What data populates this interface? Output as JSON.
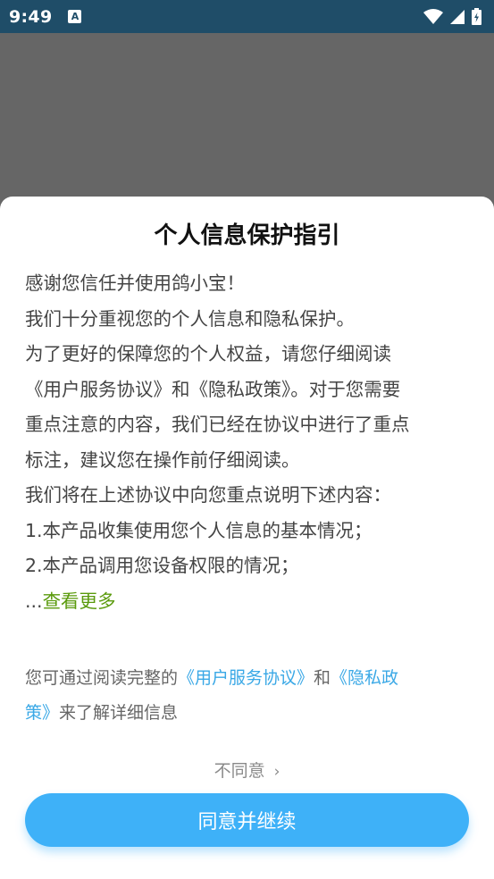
{
  "status_bar": {
    "time": "9:49",
    "notification_icon": "A",
    "icons": [
      "wifi-icon",
      "signal-icon",
      "battery-icon"
    ]
  },
  "dialog": {
    "title": "个人信息保护指引",
    "paragraph_lines": [
      "感谢您信任并使用鸽小宝！",
      "我们十分重视您的个人信息和隐私保护。",
      "为了更好的保障您的个人权益，请您仔细阅读",
      "《用户服务协议》和《隐私政策》。对于您需要",
      "重点注意的内容，我们已经在协议中进行了重点",
      "标注，建议您在操作前仔细阅读。",
      "我们将在上述协议中向您重点说明下述内容：",
      "1.本产品收集使用您个人信息的基本情况；",
      "2.本产品调用您设备权限的情况；"
    ],
    "more_prefix": "...",
    "more_link": "查看更多",
    "notice": {
      "prefix": "您可通过阅读完整的",
      "link_user_agreement": "《用户服务协议》",
      "middle": "和",
      "link_privacy_part1": "《隐私政",
      "link_privacy_part2": "策》",
      "suffix": "来了解详细信息"
    },
    "disagree_label": "不同意",
    "disagree_chevron": "›",
    "agree_label": "同意并继续"
  },
  "colors": {
    "status_bar": "#1f4d68",
    "overlay": "#666666",
    "link_green": "#5a9a0c",
    "link_blue": "#3aa8e6",
    "button": "#3eb1f8"
  }
}
